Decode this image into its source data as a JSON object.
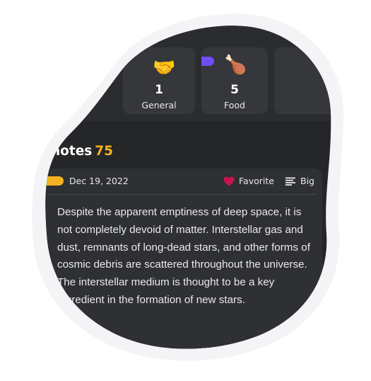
{
  "categories": [
    {
      "emoji": "🤝",
      "count": "1",
      "label": "General",
      "icon_name": "handshake-icon"
    },
    {
      "emoji": "🍗",
      "count": "5",
      "label": "Food",
      "icon_name": "poultry-leg-icon",
      "tag_color": "#6f4ef6"
    },
    {
      "emoji": "",
      "count": "",
      "label": ""
    }
  ],
  "section": {
    "title": "notes",
    "count": "75"
  },
  "note": {
    "tag_color": "#f5b121",
    "date": "Dec 19, 2022",
    "favorite_label": "Favorite",
    "favorite_color": "#c8154f",
    "size_label": "Big",
    "body": "Despite the apparent emptiness of deep space, it is not completely devoid of matter. Interstellar gas and dust, remnants of long-dead stars, and other forms of cosmic debris are scattered throughout the universe. The interstellar medium is thought to be a key ingredient in the formation of new stars."
  }
}
